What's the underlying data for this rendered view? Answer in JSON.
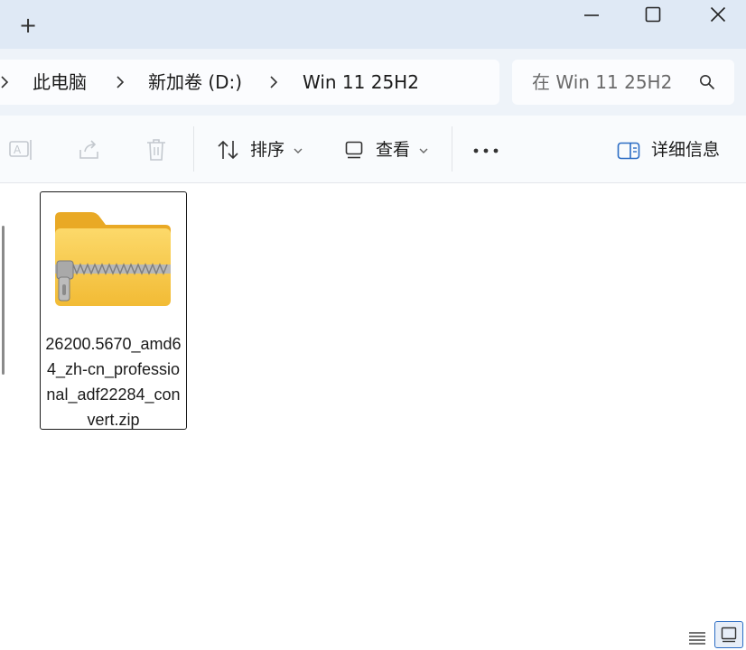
{
  "titlebar": {
    "new_tab": "+",
    "icons": [
      "plus-icon",
      "minimize-icon",
      "maximize-icon",
      "close-icon"
    ]
  },
  "address": {
    "crumbs": [
      "此电脑",
      "新加卷 (D:)",
      "Win 11 25H2"
    ],
    "search_placeholder": "在 Win 11 25H2",
    "icons": [
      "chevron-right-icon",
      "search-icon"
    ]
  },
  "toolbar": {
    "sort_label": "排序",
    "view_label": "查看",
    "details_label": "详细信息",
    "icons": [
      "rename-icon",
      "share-icon",
      "delete-icon",
      "sort-icon",
      "view-icon",
      "more-icon",
      "details-pane-icon",
      "chevron-down-icon"
    ],
    "disabled_color": "#c3c8ce"
  },
  "files": [
    {
      "name": "26200.5670_amd64_zh-cn_professional_adf22284_convert.zip",
      "icon": "zip-folder-icon"
    }
  ],
  "statusbar": {
    "icons": [
      "details-view-icon",
      "large-icons-view-icon"
    ]
  },
  "colors": {
    "titlebar_bg": "#dfe9f5",
    "addressbar_bg": "#eef3f9",
    "folder_yellow": "#f7c94a",
    "accent": "#2b6cc4"
  }
}
